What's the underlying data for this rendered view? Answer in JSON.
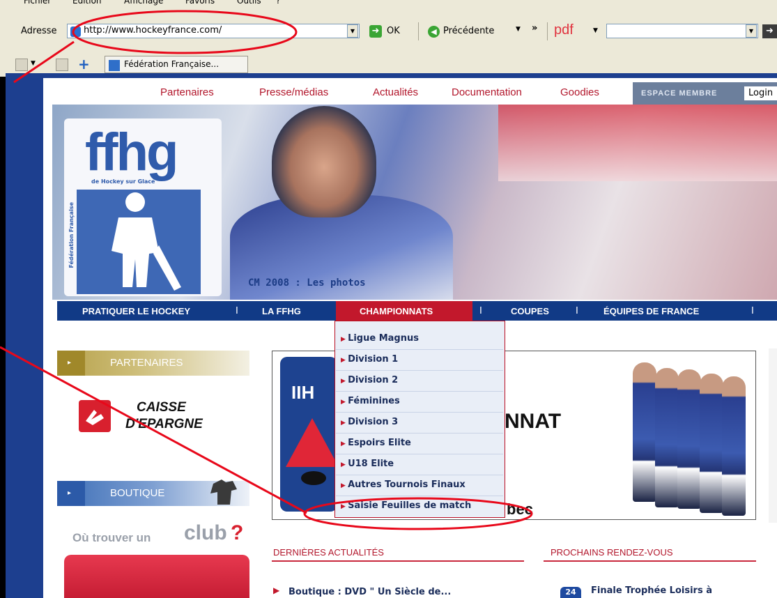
{
  "browser": {
    "menu": [
      "Fichier",
      "Edition",
      "Affichage",
      "Favoris",
      "Outils",
      "?"
    ],
    "address_label": "Adresse",
    "url": "http://www.hockeyfrance.com/",
    "go_label": "OK",
    "back_label": "Précédente",
    "more": "»",
    "pdf_label": "pdf",
    "tab_label": "Fédération Française..."
  },
  "top_nav": [
    "Partenaires",
    "Presse/médias",
    "Actualités",
    "Documentation",
    "Goodies"
  ],
  "member": {
    "label": "ESPACE MEMBRE",
    "login": "Login"
  },
  "logo": {
    "text": "ffhg",
    "sub": "de Hockey sur Glace",
    "vertical": "Fédération Française"
  },
  "banner_caption": "CM 2008 : Les photos",
  "main_nav": {
    "items": [
      "PRATIQUER LE HOCKEY",
      "LA FFHG",
      "CHAMPIONNATS",
      "COUPES",
      "ÉQUIPES DE FRANCE"
    ],
    "separator": "I"
  },
  "dropdown": [
    "Ligue Magnus",
    "Division 1",
    "Division 2",
    "Féminines",
    "Division 3",
    "Espoirs Elite",
    "U18 Elite",
    "Autres Tournois Finaux",
    "Saisie Feuilles de match"
  ],
  "sidebar": {
    "partners_title": "PARTENAIRES",
    "sponsor_line1": "CAISSE",
    "sponsor_line2": "D'EPARGNE",
    "shop_title": "BOUTIQUE",
    "club_prefix": "Où trouver un",
    "club_word": "club",
    "club_q": "?"
  },
  "feature": {
    "logo_text": "IIH",
    "headline_part": "NNAT",
    "tail_part": "bec"
  },
  "news": {
    "title": "DERNIÈRES ACTUALITÉS",
    "items": [
      "Boutique : DVD \" Un Siècle de..."
    ]
  },
  "events": {
    "title": "PROCHAINS RENDEZ-VOUS",
    "items": [
      {
        "day": "24",
        "text": "Finale Trophée Loisirs à"
      }
    ]
  },
  "colors": {
    "brand_red": "#c2182c",
    "nav_blue": "#113a86",
    "annotation_red": "#e8081a"
  }
}
